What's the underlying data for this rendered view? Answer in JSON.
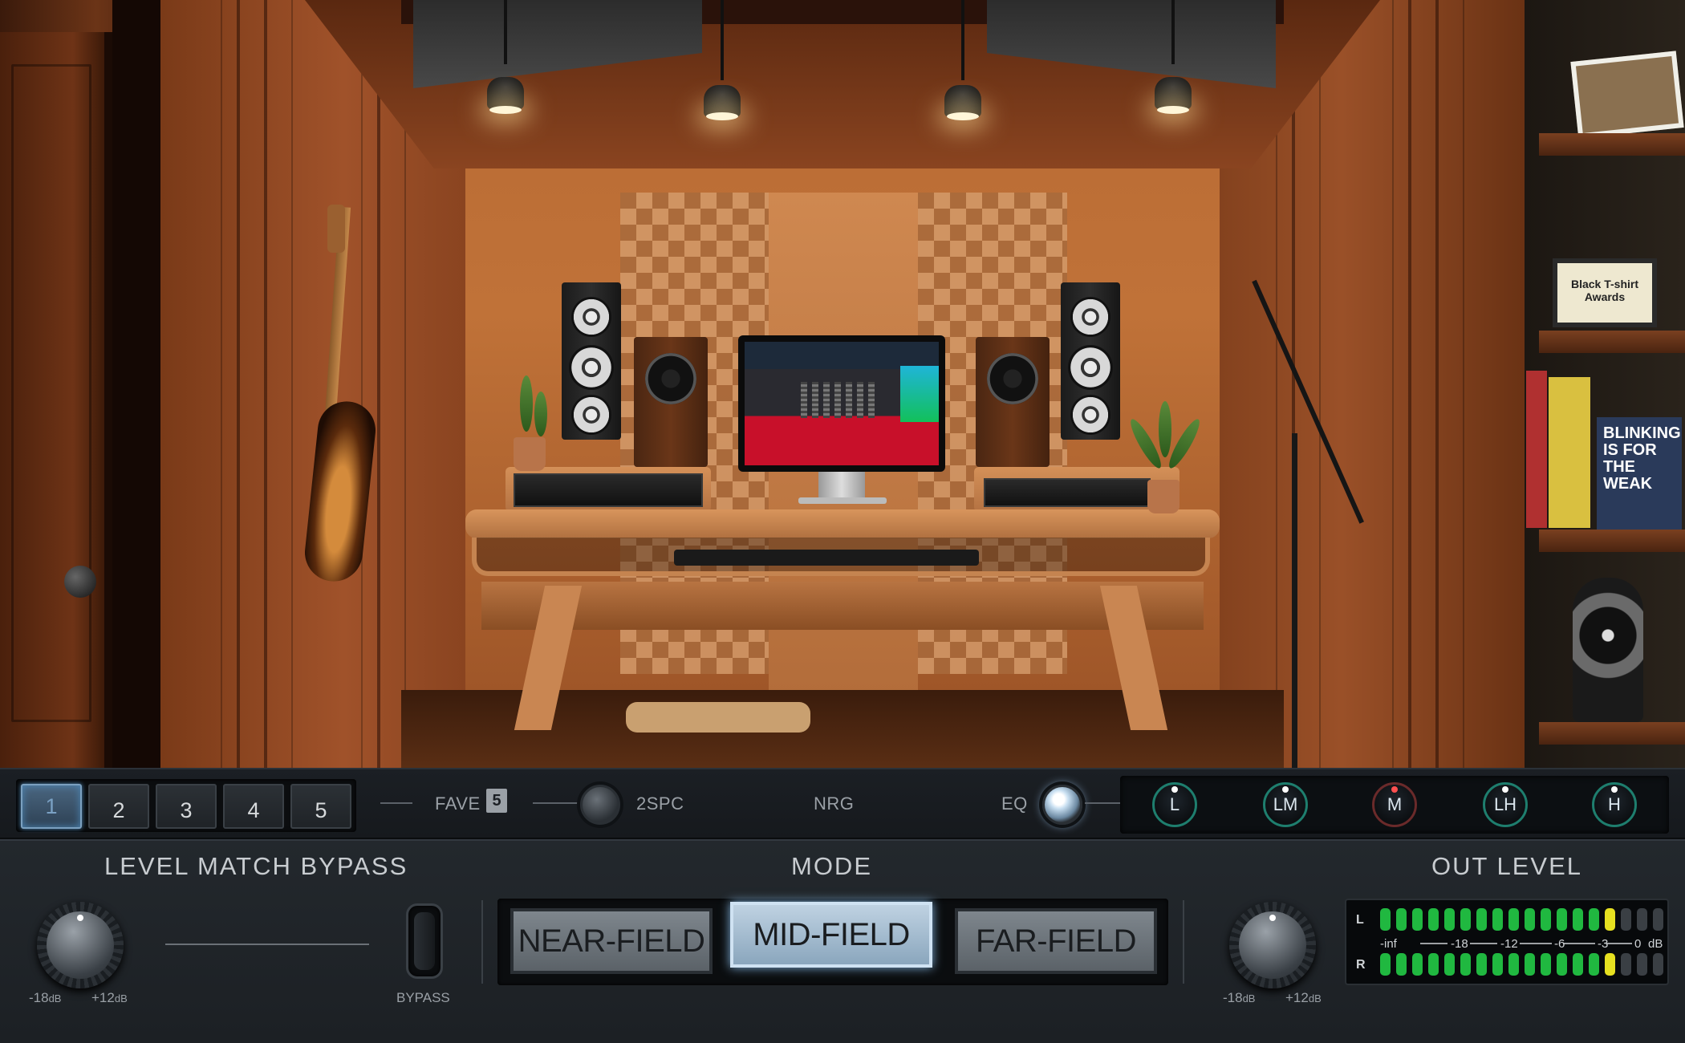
{
  "favorites": {
    "buttons": [
      "1",
      "2",
      "3",
      "4",
      "5"
    ],
    "active_index": 0,
    "label": "FAVE",
    "icon_number": "5"
  },
  "topbar": {
    "twospc_label": "2SPC",
    "nrg_label": "NRG",
    "eq_label": "EQ",
    "eq_bands": [
      {
        "label": "L",
        "indicator": "white"
      },
      {
        "label": "LM",
        "indicator": "white"
      },
      {
        "label": "M",
        "indicator": "red"
      },
      {
        "label": "LH",
        "indicator": "white"
      },
      {
        "label": "H",
        "indicator": "white"
      }
    ]
  },
  "level_match": {
    "title": "LEVEL MATCH BYPASS",
    "knob_min_value": "-18",
    "knob_min_unit": "dB",
    "knob_max_value": "+12",
    "knob_max_unit": "dB",
    "bypass_label": "BYPASS"
  },
  "mode": {
    "title": "MODE",
    "options": [
      "NEAR-FIELD",
      "MID-FIELD",
      "FAR-FIELD"
    ],
    "active_index": 1
  },
  "out_level": {
    "title": "OUT LEVEL",
    "knob_min_value": "-18",
    "knob_min_unit": "dB",
    "knob_max_value": "+12",
    "knob_max_unit": "dB",
    "meter": {
      "channels": [
        "L",
        "R"
      ],
      "scale": [
        "-inf",
        "-18",
        "-12",
        "-6",
        "-3",
        "0",
        "dB"
      ],
      "segments_total": 18,
      "segments_green": 14,
      "segments_yellow": 1
    }
  },
  "room": {
    "certificate_text": "Black T-shirt Awards",
    "book_text": "BLINKING IS FOR THE WEAK"
  },
  "colors": {
    "accent_blue": "#7fb0d9",
    "meter_green": "#20b840",
    "meter_yellow": "#e6e020",
    "eq_ring": "#1e7e6e"
  }
}
